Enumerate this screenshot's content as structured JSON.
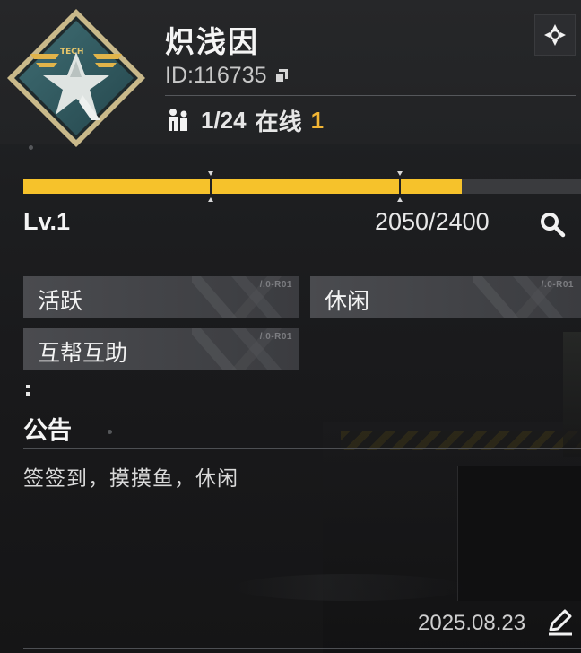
{
  "guild": {
    "name": "炽浅因",
    "id_label": "ID:116735",
    "members": "1/24",
    "online_label": "在线",
    "online_count": "1",
    "emblem_text": "TECH"
  },
  "progress": {
    "level": "Lv.1",
    "current_xp": "2050/2400",
    "fill_fraction": 0.8542
  },
  "tags": [
    {
      "label": "活跃",
      "code": "/.0-R01"
    },
    {
      "label": "休闲",
      "code": "/.0-R01"
    },
    {
      "label": "互帮互助",
      "code": "/.0-R01"
    }
  ],
  "notice": {
    "title": "公告",
    "body": "签签到，摸摸鱼，休闲",
    "date": "2025.08.23"
  },
  "icons": {
    "settings": "settings-icon",
    "copy": "copy-icon",
    "members": "members-icon",
    "search": "search-icon",
    "edit": "pencil-icon"
  },
  "colors": {
    "accent": "#f6c22b",
    "online": "#f2b534",
    "background": "#1b1c1e"
  }
}
